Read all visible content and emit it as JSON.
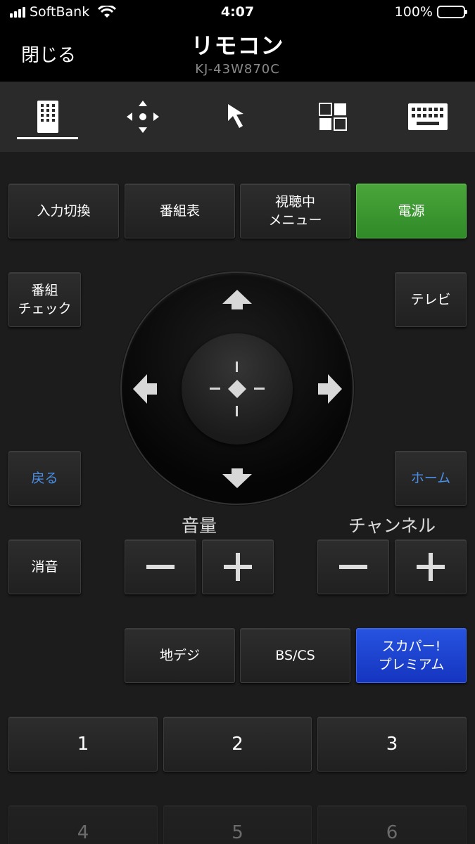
{
  "status_bar": {
    "carrier": "SoftBank",
    "time": "4:07",
    "battery": "100%"
  },
  "navbar": {
    "close_label": "閉じる",
    "title": "リモコン",
    "subtitle": "KJ-43W870C"
  },
  "tabs": [
    {
      "icon": "remote-keypad-icon",
      "active": true
    },
    {
      "icon": "dpad-icon",
      "active": false
    },
    {
      "icon": "pointer-icon",
      "active": false
    },
    {
      "icon": "apps-grid-icon",
      "active": false
    },
    {
      "icon": "keyboard-icon",
      "active": false
    }
  ],
  "buttons": {
    "input": "入力切換",
    "guide": "番組表",
    "options": "視聴中\nメニュー",
    "power": "電源",
    "program_check": "番組\nチェック",
    "tv": "テレビ",
    "back": "戻る",
    "home": "ホーム",
    "mute": "消音",
    "terrestrial": "地デジ",
    "bscs": "BS/CS",
    "skyperfect": "スカパー!\nプレミアム"
  },
  "labels": {
    "volume": "音量",
    "channel": "チャンネル"
  },
  "numpad": [
    "1",
    "2",
    "3",
    "4",
    "5",
    "6"
  ],
  "colors": {
    "power": "#3a9a30",
    "skyperfect": "#1d44d0",
    "link": "#4a8fe6"
  }
}
